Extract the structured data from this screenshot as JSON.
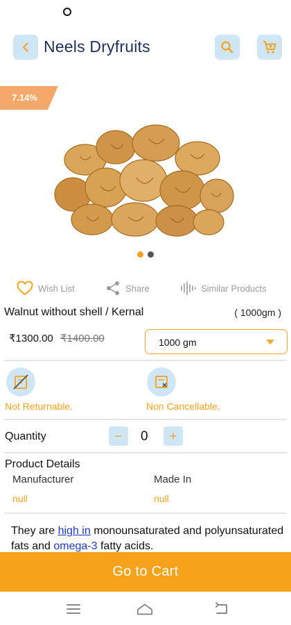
{
  "header": {
    "title": "Neels Dryfruits",
    "back_icon": "chevron-left-icon",
    "search_icon": "search-icon",
    "cart_icon": "cart-icon"
  },
  "product": {
    "discount": "7.14%",
    "name": "Walnut without shell / Kernal",
    "weight": "( 1000gm )",
    "price": "₹1300.00",
    "mrp": "₹1400.00",
    "selected_variant": "1000 gm",
    "image_count": 2,
    "active_image": 1
  },
  "actions": {
    "wishlist": "Wish List",
    "share": "Share",
    "similar": "Similar Products"
  },
  "policies": {
    "returnable": "Not Returnable.",
    "cancellable": "Non Cancellable."
  },
  "quantity": {
    "label": "Quantity",
    "minus": "−",
    "plus": "+",
    "value": "0"
  },
  "details": {
    "title": "Product Details",
    "manufacturer_label": "Manufacturer",
    "manufacturer_value": "null",
    "made_in_label": "Made In",
    "made_in_value": "null"
  },
  "description": {
    "part1": "They are ",
    "link1": "high in",
    "part2": " monounsaturated and polyunsaturated fats and ",
    "link2": "omega-3",
    "part3": " fatty acids."
  },
  "cta": {
    "go_to_cart": "Go to Cart"
  },
  "colors": {
    "accent": "#f7a21b",
    "icon_bg": "#cfe6f7",
    "title": "#1e2f5c",
    "discount_tag": "#f4a869",
    "link": "#1a39c9"
  }
}
